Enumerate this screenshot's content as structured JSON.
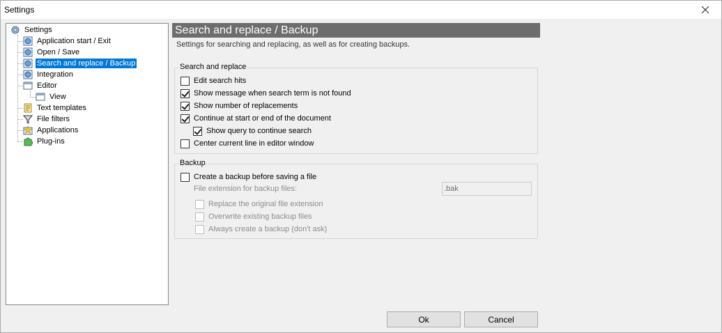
{
  "window": {
    "title": "Settings"
  },
  "tree": {
    "root": "Settings",
    "items": [
      {
        "label": "Application start / Exit",
        "icon": "globe-icon"
      },
      {
        "label": "Open / Save",
        "icon": "globe-icon"
      },
      {
        "label": "Search and replace / Backup",
        "icon": "globe-icon",
        "selected": true
      },
      {
        "label": "Integration",
        "icon": "globe-icon"
      },
      {
        "label": "Editor",
        "icon": "window-icon"
      },
      {
        "label": "View",
        "icon": "window-icon",
        "child": true
      },
      {
        "label": "Text templates",
        "icon": "document-icon"
      },
      {
        "label": "File filters",
        "icon": "funnel-icon"
      },
      {
        "label": "Applications",
        "icon": "star-icon"
      },
      {
        "label": "Plug-ins",
        "icon": "puzzle-icon"
      }
    ]
  },
  "page": {
    "title": "Search and replace / Backup",
    "subtitle": "Settings for searching and replacing, as well as for creating backups."
  },
  "search": {
    "group_title": "Search and replace",
    "options": [
      {
        "label": "Edit search hits",
        "checked": false
      },
      {
        "label": "Show message when search term is not found",
        "checked": true
      },
      {
        "label": "Show number of replacements",
        "checked": true
      },
      {
        "label": "Continue at start or end of the document",
        "checked": true
      },
      {
        "label": "Show query to continue search",
        "checked": true
      },
      {
        "label": "Center current line in editor window",
        "checked": false
      }
    ]
  },
  "backup": {
    "group_title": "Backup",
    "create_label": "Create a backup before saving a file",
    "create_checked": false,
    "ext_label": "File extension for backup files:",
    "ext_value": ".bak",
    "options": [
      {
        "label": "Replace the original file extension",
        "checked": false
      },
      {
        "label": "Overwrite existing backup files",
        "checked": false
      },
      {
        "label": "Always create a backup (don't ask)",
        "checked": false
      }
    ]
  },
  "buttons": {
    "ok": "Ok",
    "cancel": "Cancel"
  },
  "colors": {
    "selection": "#0078d7",
    "header_bar": "#6d6d6d"
  }
}
